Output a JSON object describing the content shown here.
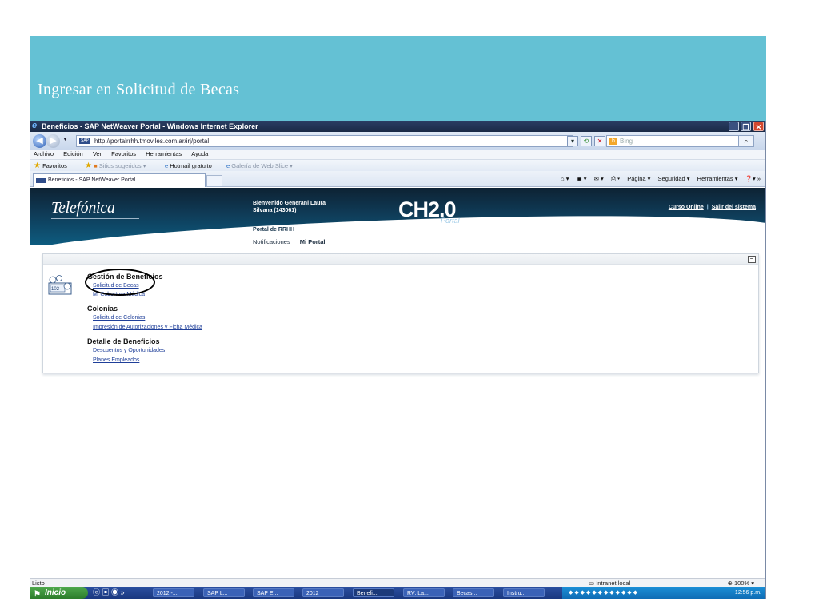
{
  "slide": {
    "title": "Ingresar en Solicitud de Becas",
    "header_color": "#64c1d4"
  },
  "window": {
    "title": "Beneficios - SAP NetWeaver Portal - Windows Internet Explorer",
    "min_icon": "_",
    "max_icon": "❐",
    "close_icon": "✕"
  },
  "addressbar": {
    "url": "http://portalrrhh.tmoviles.com.ar/irj/portal",
    "search_placeholder": "Bing"
  },
  "menubar": {
    "items": [
      "Archivo",
      "Edición",
      "Ver",
      "Favoritos",
      "Herramientas",
      "Ayuda"
    ]
  },
  "favbar": {
    "favorites": "Favoritos",
    "sitios": "Sitios sugeridos ▾",
    "hotmail": "Hotmail gratuito",
    "galeria": "Galería de Web Slice ▾"
  },
  "tab": {
    "label": "Beneficios - SAP NetWeaver Portal"
  },
  "commandbar": {
    "pagina": "Página ▾",
    "seguridad": "Seguridad ▾",
    "herramientas": "Herramientas ▾"
  },
  "portal": {
    "logo": "Telefónica",
    "welcome_line1": "Bienvenido Generani Laura",
    "welcome_line2": "Silvana (143061)",
    "portal_rrhh": "Portal de RRHH",
    "ch_logo": "CH2.0",
    "ch_sub": "Portal",
    "curso_online": "Curso Online",
    "salir": "Salir del sistema",
    "nav": [
      "Notificaciones",
      "Mi Portal"
    ]
  },
  "content": {
    "sections": [
      {
        "heading": "Gestión de Beneficios",
        "links": [
          "Solicitud de Becas",
          "Mi Cobertura Médica"
        ]
      },
      {
        "heading": "Colonias",
        "links": [
          "Solicitud de Colonias",
          "Impresión de Autorizaciones y Ficha Médica"
        ]
      },
      {
        "heading": "Detalle de Beneficios",
        "links": [
          "Descuentos y Oportunidades",
          "Planes Empleados"
        ]
      }
    ]
  },
  "statusbar": {
    "left": "Listo",
    "zone": "Intranet local",
    "zoom": "100% ▾"
  },
  "taskbar": {
    "start": "Inicio",
    "items": [
      "2012 -...",
      "SAP L...",
      "SAP E...",
      "2012",
      "Benefi...",
      "RV: La...",
      "Becas...",
      "Instru..."
    ],
    "clock": "12:56 p.m."
  }
}
